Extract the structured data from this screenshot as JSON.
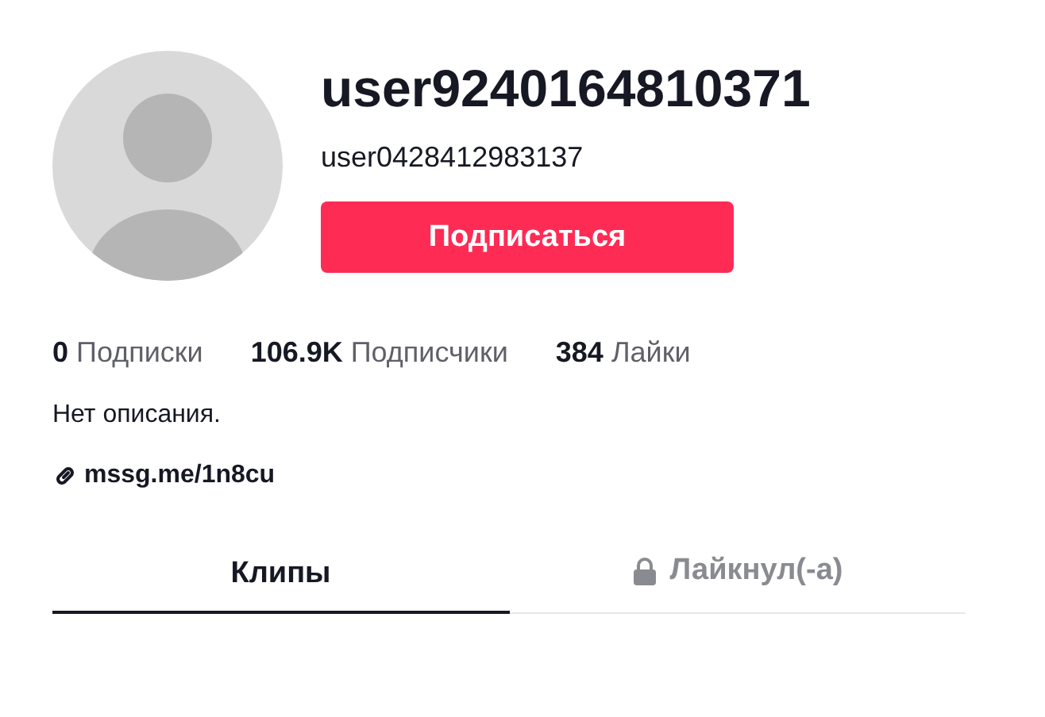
{
  "profile": {
    "username": "user9240164810371",
    "nickname": "user0428412983137",
    "follow_button": "Подписаться"
  },
  "stats": [
    {
      "count": "0",
      "caption": "Подписки"
    },
    {
      "count": "106.9K",
      "caption": "Подписчики"
    },
    {
      "count": "384",
      "caption": "Лайки"
    }
  ],
  "bio": "Нет описания.",
  "link": "mssg.me/1n8cu",
  "tabs": [
    {
      "label": "Клипы",
      "selected": true,
      "locked": false
    },
    {
      "label": "Лайкнул(-а)",
      "selected": false,
      "locked": true
    }
  ]
}
